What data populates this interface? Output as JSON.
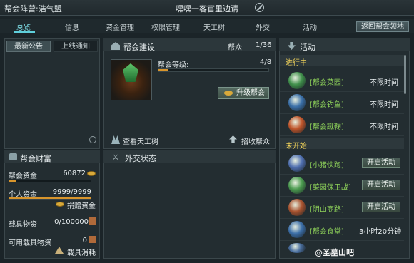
{
  "title": {
    "guild_camp_label": "帮会阵营",
    "guild_camp_value": "浩气盟",
    "center_text": "嘿嘿一客官里边请"
  },
  "tabs": [
    "总览",
    "信息",
    "资金管理",
    "权限管理",
    "天工树",
    "外交",
    "活动"
  ],
  "return_button": "返回帮会领地",
  "notice": {
    "tab_latest": "最新公告",
    "tab_online": "上线通知"
  },
  "build": {
    "title": "帮会建设",
    "members_label": "帮众",
    "members_value": "1/36",
    "level_label": "帮会等级:",
    "level_value": "4/8",
    "level_progress": 0.09,
    "upgrade_button": "升级帮会",
    "tech_tree_link": "查看天工树",
    "recruit_link": "招收帮众"
  },
  "wealth": {
    "title": "帮会财富",
    "fund_label": "帮会资金",
    "fund_value": "60872",
    "fund_progress": 0.08,
    "personal_label": "个人资金",
    "personal_value": "9999/9999",
    "personal_progress": 1.0,
    "donate_link": "捐赠资金",
    "vehicle_label": "载具物资",
    "vehicle_value": "0/100000",
    "usable_label": "可用载具物资",
    "usable_value": "0",
    "consume_link": "载具消耗"
  },
  "diplomacy": {
    "title": "外交状态"
  },
  "activities": {
    "title": "活动",
    "ongoing_label": "进行中",
    "upcoming_label": "未开始",
    "ongoing": [
      {
        "name": "[帮会菜园]",
        "time": "不限时间",
        "color": "#3f8f4a"
      },
      {
        "name": "[帮会钓鱼]",
        "time": "不限时间",
        "color": "#3a6fa8"
      },
      {
        "name": "[帮会蹴鞠]",
        "time": "不限时间",
        "color": "#c0552a"
      }
    ],
    "upcoming": [
      {
        "name": "[小猪快跑]",
        "button": "开启活动",
        "color": "#4f6fb0"
      },
      {
        "name": "[菜园保卫战]",
        "button": "开启活动",
        "color": "#4a9a4e"
      },
      {
        "name": "[阴山商路]",
        "button": "开启活动",
        "color": "#a8522e"
      },
      {
        "name": "[帮会食堂]",
        "time": "3小时20分钟",
        "color": "#3b6ea8"
      }
    ]
  },
  "watermark": "@圣墓山吧"
}
